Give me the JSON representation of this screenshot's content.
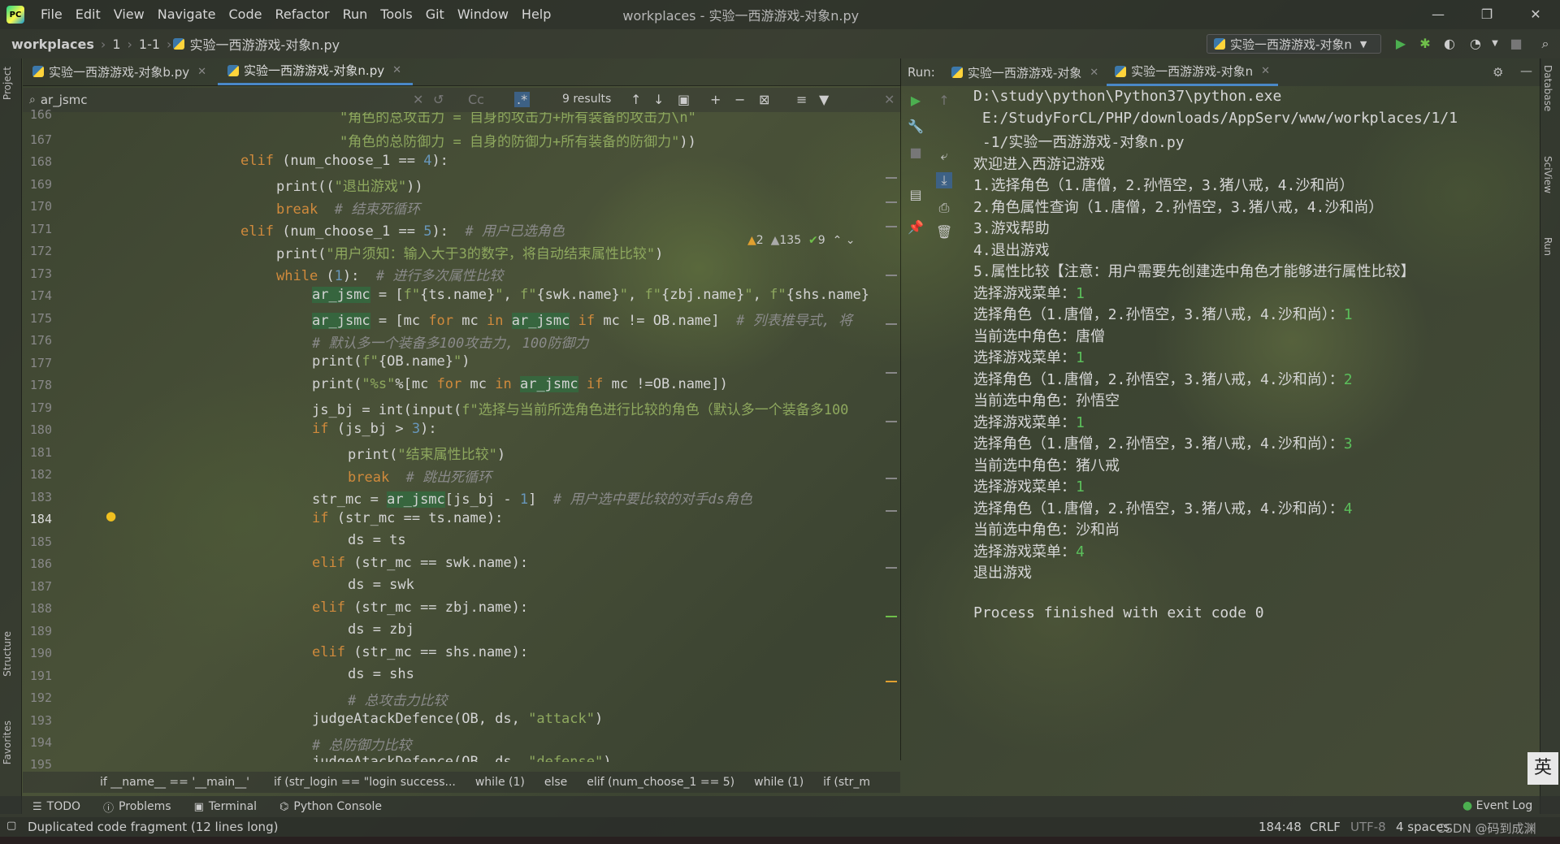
{
  "titlebar": {
    "menu": [
      "File",
      "Edit",
      "View",
      "Navigate",
      "Code",
      "Refactor",
      "Run",
      "Tools",
      "Git",
      "Window",
      "Help"
    ],
    "title": "workplaces - 实验一西游游戏-对象n.py",
    "controls": [
      "—",
      "❐",
      "✕"
    ]
  },
  "nav": {
    "crumbs": [
      "workplaces",
      "1",
      "1-1",
      "实验一西游游戏-对象n.py"
    ],
    "run_config": "实验一西游游戏-对象n"
  },
  "left_strip": {
    "project": "Project",
    "structure": "Structure",
    "favorites": "Favorites"
  },
  "right_strip": {
    "database": "Database",
    "sciview": "SciView",
    "run": "Run"
  },
  "editor": {
    "tabs": [
      {
        "label": "实验一西游游戏-对象b.py"
      },
      {
        "label": "实验一西游游戏-对象n.py"
      }
    ],
    "search": {
      "query": "ar_jsmc",
      "results": "9 results"
    },
    "inspections": {
      "warn": "2",
      "weak": "135",
      "ok": "9"
    },
    "line_numbers": [
      "166",
      "167",
      "168",
      "169",
      "170",
      "171",
      "172",
      "173",
      "174",
      "175",
      "176",
      "177",
      "178",
      "179",
      "180",
      "181",
      "182",
      "183",
      "184",
      "185",
      "186",
      "187",
      "188",
      "189",
      "190",
      "191",
      "192",
      "193",
      "194",
      "195"
    ],
    "current_line": "184"
  },
  "crumbs": [
    "if __name__ == '__main__'",
    "if (str_login == \"login success...",
    "while (1)",
    "else",
    "elif (num_choose_1 == 5)",
    "while (1)",
    "if (str_m"
  ],
  "run": {
    "label": "Run:",
    "tabs": [
      "实验一西游游戏-对象",
      "实验一西游游戏-对象n"
    ]
  },
  "console": [
    {
      "t": "D:\\study\\python\\Python37\\python.exe"
    },
    {
      "t": " E:/StudyForCL/PHP/downloads/AppServ/www/workplaces/1/1"
    },
    {
      "t": " -1/实验一西游游戏-对象n.py"
    },
    {
      "t": "欢迎进入西游记游戏"
    },
    {
      "t": "1.选择角色（1.唐僧，2.孙悟空，3.猪八戒，4.沙和尚）"
    },
    {
      "t": "2.角色属性查询（1.唐僧，2.孙悟空，3.猪八戒，4.沙和尚）"
    },
    {
      "t": "3.游戏帮助"
    },
    {
      "t": "4.退出游戏"
    },
    {
      "t": "5.属性比较【注意：用户需要先创建选中角色才能够进行属性比较】"
    },
    {
      "t": "选择游戏菜单：",
      "i": "1"
    },
    {
      "t": "选择角色（1.唐僧，2.孙悟空，3.猪八戒，4.沙和尚）：",
      "i": "1"
    },
    {
      "t": "当前选中角色：唐僧"
    },
    {
      "t": "选择游戏菜单：",
      "i": "1"
    },
    {
      "t": "选择角色（1.唐僧，2.孙悟空，3.猪八戒，4.沙和尚）：",
      "i": "2"
    },
    {
      "t": "当前选中角色：孙悟空"
    },
    {
      "t": "选择游戏菜单：",
      "i": "1"
    },
    {
      "t": "选择角色（1.唐僧，2.孙悟空，3.猪八戒，4.沙和尚）：",
      "i": "3"
    },
    {
      "t": "当前选中角色：猪八戒"
    },
    {
      "t": "选择游戏菜单：",
      "i": "1"
    },
    {
      "t": "选择角色（1.唐僧，2.孙悟空，3.猪八戒，4.沙和尚）：",
      "i": "4"
    },
    {
      "t": "当前选中角色：沙和尚"
    },
    {
      "t": "选择游戏菜单：",
      "i": "4"
    },
    {
      "t": "退出游戏"
    },
    {
      "t": ""
    },
    {
      "t": "Process finished with exit code 0"
    }
  ],
  "bottom": {
    "tools": [
      "TODO",
      "Problems",
      "Terminal",
      "Python Console"
    ],
    "event_log": "Event Log"
  },
  "status": {
    "message": "Duplicated code fragment (12 lines long)",
    "position": "184:48",
    "line_sep": "CRLF",
    "encoding": "UTF-8",
    "indent": "4 spaces",
    "watermark": "CSDN @码到成渊",
    "ime": "英"
  }
}
